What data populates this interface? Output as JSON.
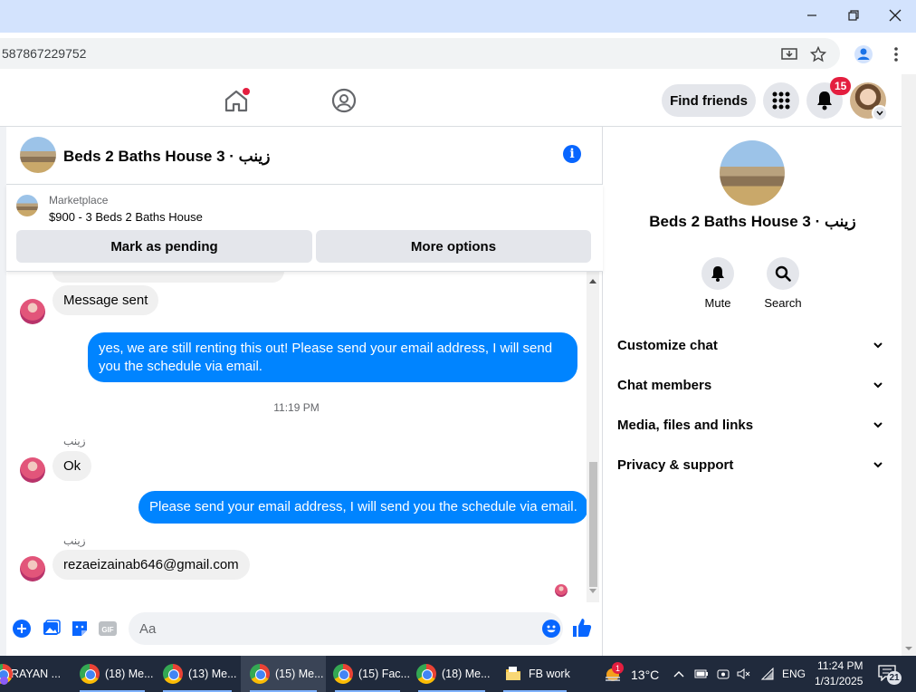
{
  "browser": {
    "url_fragment": "587867229752",
    "window_controls": [
      "minimize",
      "restore",
      "close"
    ]
  },
  "fb_header": {
    "find_friends_label": "Find friends",
    "notification_count": "15"
  },
  "chat": {
    "title": "Beds 2 Baths House 3 · زينب",
    "marketplace": {
      "label": "Marketplace",
      "listing": "$900 - 3 Beds 2 Baths House"
    },
    "mark_pending_label": "Mark as pending",
    "more_options_label": "More options",
    "messages": [
      {
        "direction": "in",
        "text": "Message sent"
      },
      {
        "direction": "out",
        "text": "yes, we are still renting this out! Please send your email address, I will send you the schedule via email."
      },
      {
        "direction": "time",
        "text": "11:19 PM"
      },
      {
        "direction": "sender",
        "text": "زينب"
      },
      {
        "direction": "in",
        "text": "Ok"
      },
      {
        "direction": "out",
        "text": "Please send your email address, I will send you the schedule via email."
      },
      {
        "direction": "sender",
        "text": "زينب"
      },
      {
        "direction": "in",
        "text": "rezaeizainab646@gmail.com"
      }
    ],
    "composer_placeholder": "Aa"
  },
  "info_panel": {
    "name": "Beds 2 Baths House 3 · زينب",
    "actions": [
      {
        "label": "Mute",
        "icon": "bell-icon"
      },
      {
        "label": "Search",
        "icon": "search-icon"
      }
    ],
    "sections": [
      "Customize chat",
      "Chat members",
      "Media, files and links",
      "Privacy & support"
    ]
  },
  "taskbar": {
    "tasks": [
      {
        "label": "RAYAN ..."
      },
      {
        "label": "(18) Me..."
      },
      {
        "label": "(13) Me..."
      },
      {
        "label": "(15) Me...",
        "active": true
      },
      {
        "label": "(15) Fac..."
      },
      {
        "label": "(18) Me..."
      },
      {
        "label": "FB work"
      }
    ],
    "weather_badge": "1",
    "temperature": "13°C",
    "language": "ENG",
    "time": "11:24 PM",
    "date": "1/31/2025",
    "notification_count": "21"
  },
  "colors": {
    "messenger_blue": "#0084ff",
    "fb_blue": "#0866ff",
    "badge_red": "#e41e3f",
    "taskbar_bg": "#202a3c"
  }
}
